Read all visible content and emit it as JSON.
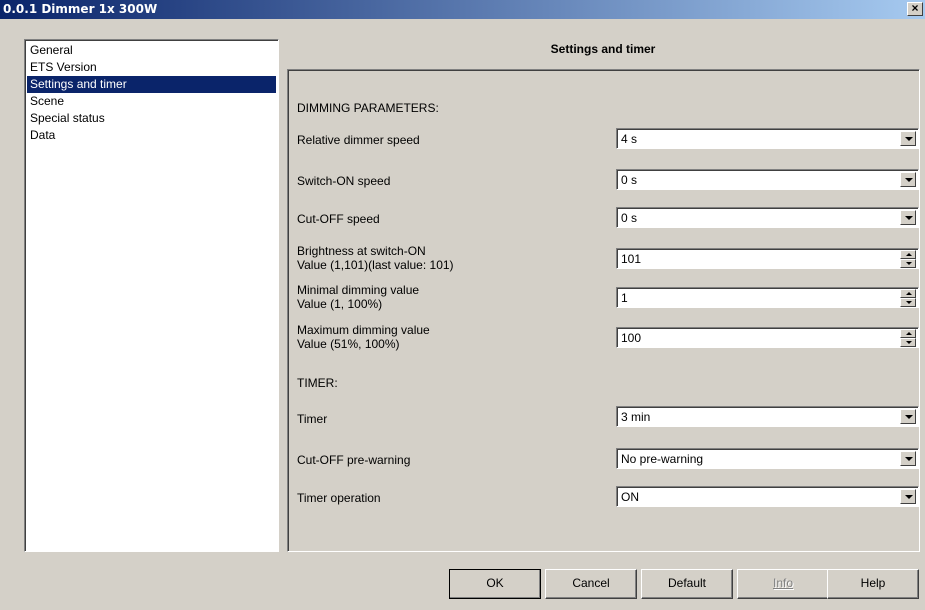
{
  "window": {
    "title": "0.0.1 Dimmer 1x 300W",
    "close_label": "×"
  },
  "nav": {
    "items": [
      {
        "label": "General"
      },
      {
        "label": "ETS Version"
      },
      {
        "label": "Settings and timer",
        "selected": true
      },
      {
        "label": "Scene"
      },
      {
        "label": "Special status"
      },
      {
        "label": "Data"
      }
    ]
  },
  "page": {
    "heading": "Settings and timer"
  },
  "dimming": {
    "section_title": "DIMMING PARAMETERS:",
    "relative_speed": {
      "label": "Relative dimmer speed",
      "value": "4 s"
    },
    "switch_on_speed": {
      "label": "Switch-ON speed",
      "value": "0 s"
    },
    "cut_off_speed": {
      "label": "Cut-OFF speed",
      "value": "0 s"
    },
    "brightness": {
      "label_line1": "Brightness at switch-ON",
      "label_line2": "Value (1,101)(last value: 101)",
      "value": "101"
    },
    "minimal": {
      "label_line1": "Minimal dimming value",
      "label_line2": "Value (1, 100%)",
      "value": "1"
    },
    "maximum": {
      "label_line1": "Maximum dimming value",
      "label_line2": "Value (51%, 100%)",
      "value": "100"
    }
  },
  "timer": {
    "section_title": "TIMER:",
    "timer": {
      "label": "Timer",
      "value": "3 min"
    },
    "pre_warning": {
      "label": "Cut-OFF pre-warning",
      "value": "No pre-warning"
    },
    "operation": {
      "label": "Timer operation",
      "value": "ON"
    }
  },
  "buttons": {
    "ok": "OK",
    "cancel": "Cancel",
    "default": "Default",
    "info": "Info",
    "help": "Help"
  },
  "colors": {
    "selection": "#0a246a",
    "title_gradient_start": "#0a246a",
    "title_gradient_end": "#a6caf0",
    "dialog_bg": "#d4d0c8"
  }
}
